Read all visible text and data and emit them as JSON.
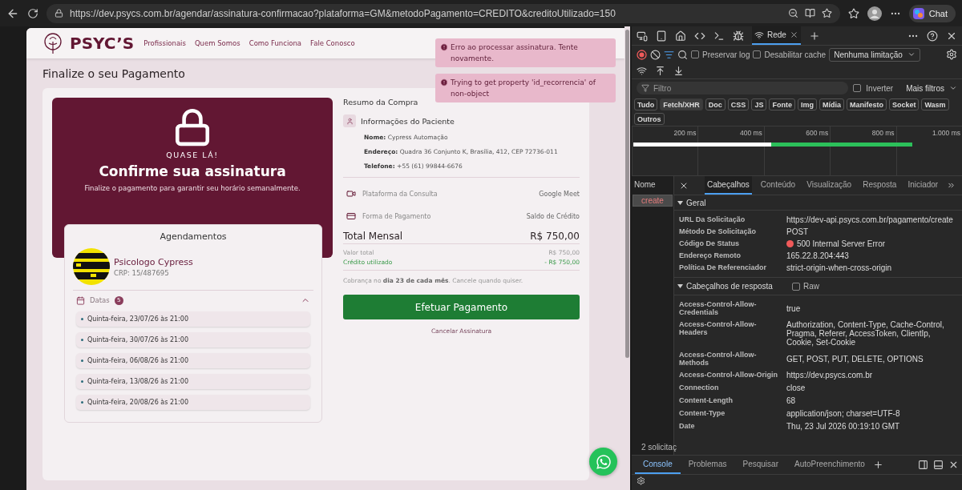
{
  "browser": {
    "url": "https://dev.psycs.com.br/agendar/assinatura-confirmacao?plataforma=GM&metodoPagamento=CREDITO&creditoUtilizado=150",
    "chat_label": "Chat"
  },
  "site": {
    "logo": "PSYC’S",
    "nav": [
      "Profissionais",
      "Quem Somos",
      "Como Funciona",
      "Fale Conosco"
    ],
    "toasts": [
      "Erro ao processar assinatura. Tente novamente.",
      "Trying to get property 'id_recorrencia' of non-object"
    ],
    "page_title": "Finalize o seu Pagamento",
    "hero": {
      "eyebrow": "QUASE LÁ!",
      "title": "Confirme sua assinatura",
      "subtitle": "Finalize o pagamento para garantir seu horário semanalmente."
    },
    "schedule": {
      "title": "Agendamentos",
      "psychologist": {
        "name": "Psicologo Cypress",
        "crp": "CRP: 15/487695"
      },
      "dates_label": "Datas",
      "dates_count": "5",
      "expanded": true,
      "dates": [
        "Quinta-feira, 23/07/26 às 21:00",
        "Quinta-feira, 30/07/26 às 21:00",
        "Quinta-feira, 06/08/26 às 21:00",
        "Quinta-feira, 13/08/26 às 21:00",
        "Quinta-feira, 20/08/26 às 21:00"
      ]
    },
    "summary": {
      "title": "Resumo da Compra",
      "patient_title": "Informações do Paciente",
      "fields": [
        "**Nome:** Cypress Automação",
        "**Endereço:** Quadra 36 Conjunto K, Brasília, 412, CEP 72736-011",
        "**Telefone:** +55 (61) 99844-6676"
      ],
      "rows": [
        {
          "kind": "video",
          "label": "Plataforma da Consulta",
          "value": "Google Meet"
        },
        {
          "kind": "card",
          "label": "Forma de Pagamento",
          "value": "Saldo de Crédito"
        }
      ],
      "total_label": "Total Mensal",
      "total_value": "R$ 750,00",
      "breakdown": [
        {
          "kind": "plain",
          "label": "Valor total",
          "value": "R$ 750,00"
        },
        {
          "kind": "credit",
          "label": "Crédito utilizado",
          "value": "- R$ 750,00"
        }
      ],
      "note": "Cobrança no **dia 23 de cada mês**. Cancele quando quiser.",
      "pay_button": "Efetuar Pagamento",
      "cancel_link": "Cancelar Assinatura"
    }
  },
  "devtools": {
    "tabs": [
      {
        "label": "Rede",
        "selected": true
      }
    ],
    "preserve_log": {
      "label": "Preservar log",
      "checked": false
    },
    "disable_cache": {
      "label": "Desabilitar cache",
      "checked": false
    },
    "throttle": "Nenhuma limitação",
    "filter_placeholder": "Filtro",
    "invert": {
      "label": "Inverter",
      "checked": false
    },
    "more_filters": "Mais filtros",
    "type_filters": [
      {
        "label": "Tudo",
        "selected": false
      },
      {
        "label": "Fetch/XHR",
        "selected": true
      },
      {
        "label": "Doc",
        "selected": false
      },
      {
        "label": "CSS",
        "selected": false
      },
      {
        "label": "JS",
        "selected": false
      },
      {
        "label": "Fonte",
        "selected": false
      },
      {
        "label": "Img",
        "selected": false
      },
      {
        "label": "Mídia",
        "selected": false
      },
      {
        "label": "Manifesto",
        "selected": false
      },
      {
        "label": "Socket",
        "selected": false
      },
      {
        "label": "Wasm",
        "selected": false
      },
      {
        "label": "Outros",
        "selected": false
      }
    ],
    "timeline_ticks": [
      "200 ms",
      "400 ms",
      "600 ms",
      "800 ms",
      "1.000 ms"
    ],
    "name_header": "Nome",
    "requests": [
      {
        "name": "create",
        "selected": true
      }
    ],
    "request_count": "2 solicitaç",
    "detail_tabs": [
      {
        "label": "Cabeçalhos",
        "selected": true
      },
      {
        "label": "Conteúdo",
        "selected": false
      },
      {
        "label": "Visualização",
        "selected": false
      },
      {
        "label": "Resposta",
        "selected": false
      },
      {
        "label": "Iniciador",
        "selected": false
      }
    ],
    "general": {
      "title": "Geral",
      "expanded": true,
      "rows": [
        {
          "kind": "text",
          "name": "URL Da Solicitação",
          "value": "https://dev-api.psycs.com.br/pagamento/create"
        },
        {
          "kind": "text",
          "name": "Método De Solicitação",
          "value": "POST"
        },
        {
          "kind": "status",
          "name": "Código De Status",
          "value": "500 Internal Server Error"
        },
        {
          "kind": "text",
          "name": "Endereço Remoto",
          "value": "165.22.8.204:443"
        },
        {
          "kind": "text",
          "name": "Política De Referenciador",
          "value": "strict-origin-when-cross-origin"
        }
      ]
    },
    "response_headers": {
      "title": "Cabeçalhos de resposta",
      "expanded": true,
      "raw": {
        "label": "Raw",
        "checked": false
      },
      "rows": [
        {
          "name": "Access-Control-Allow-Credentials",
          "value": "true"
        },
        {
          "name": "Access-Control-Allow-Headers",
          "value": "Authorization, Content-Type, Cache-Control, Pragma, Referer, AccessToken, ClientIp, Cookie, Set-Cookie"
        },
        {
          "name": "Access-Control-Allow-Methods",
          "value": "GET, POST, PUT, DELETE, OPTIONS"
        },
        {
          "name": "Access-Control-Allow-Origin",
          "value": "https://dev.psycs.com.br"
        },
        {
          "name": "Connection",
          "value": "close"
        },
        {
          "name": "Content-Length",
          "value": "68"
        },
        {
          "name": "Content-Type",
          "value": "application/json; charset=UTF-8"
        },
        {
          "name": "Date",
          "value": "Thu, 23 Jul 2026 00:19:10 GMT"
        }
      ]
    },
    "drawer_tabs": [
      {
        "label": "Console",
        "selected": true
      },
      {
        "label": "Problemas",
        "selected": false
      },
      {
        "label": "Pesquisar",
        "selected": false
      },
      {
        "label": "AutoPreenchimento",
        "selected": false
      }
    ]
  }
}
